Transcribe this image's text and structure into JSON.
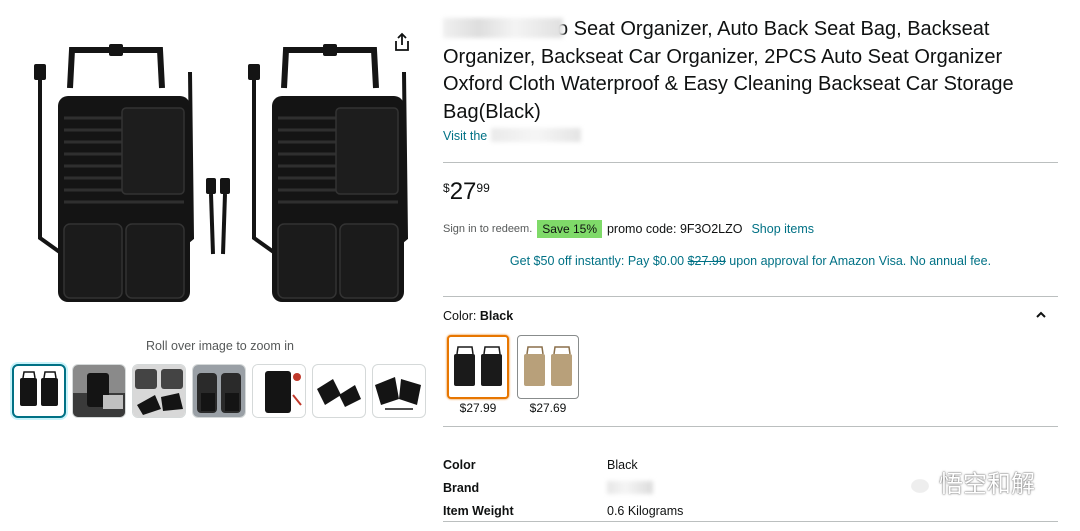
{
  "gallery": {
    "zoom_hint": "Roll over image to zoom in",
    "thumbnails": [
      {
        "name": "thumb-pair-front",
        "selected": true
      },
      {
        "name": "thumb-car-interior",
        "selected": false
      },
      {
        "name": "thumb-car-seats",
        "selected": false
      },
      {
        "name": "thumb-seat-installed",
        "selected": false
      },
      {
        "name": "thumb-detail",
        "selected": false
      },
      {
        "name": "thumb-folded",
        "selected": false
      },
      {
        "name": "thumb-folded-pair",
        "selected": false
      }
    ]
  },
  "product": {
    "title_rest": "o Seat Organizer, Auto Back Seat Bag, Backseat Organizer, Backseat Car Organizer, 2PCS Auto Seat Organizer Oxford Cloth Waterproof & Easy Cleaning Backseat Car Storage Bag(Black)",
    "store_prefix": "Visit the",
    "price": {
      "symbol": "$",
      "whole": "27",
      "fraction": "99"
    },
    "promo": {
      "sign_in": "Sign in to redeem.",
      "badge": "Save 15%",
      "code_text": "promo code: 9F3O2LZO",
      "shop_link": "Shop items"
    },
    "visa": {
      "before": "Get $50 off instantly: Pay $0.00 ",
      "strike": "$27.99",
      "after": " upon approval for Amazon Visa. No annual fee."
    },
    "color": {
      "label": "Color:",
      "value": "Black",
      "options": [
        {
          "name": "Black",
          "price": "$27.99",
          "selected": true,
          "fill": "#1a1a1a"
        },
        {
          "name": "Khaki",
          "price": "$27.69",
          "selected": false,
          "fill": "#b8a07a"
        }
      ]
    },
    "specs": [
      {
        "key": "Color",
        "value": "Black"
      },
      {
        "key": "Brand",
        "value": ""
      },
      {
        "key": "Item Weight",
        "value": "0.6 Kilograms"
      }
    ]
  },
  "watermark": {
    "text": "悟空和解"
  },
  "colors": {
    "link": "#007185",
    "badge": "#7fda69",
    "selected_border": "#e77600",
    "product": "#141414"
  }
}
